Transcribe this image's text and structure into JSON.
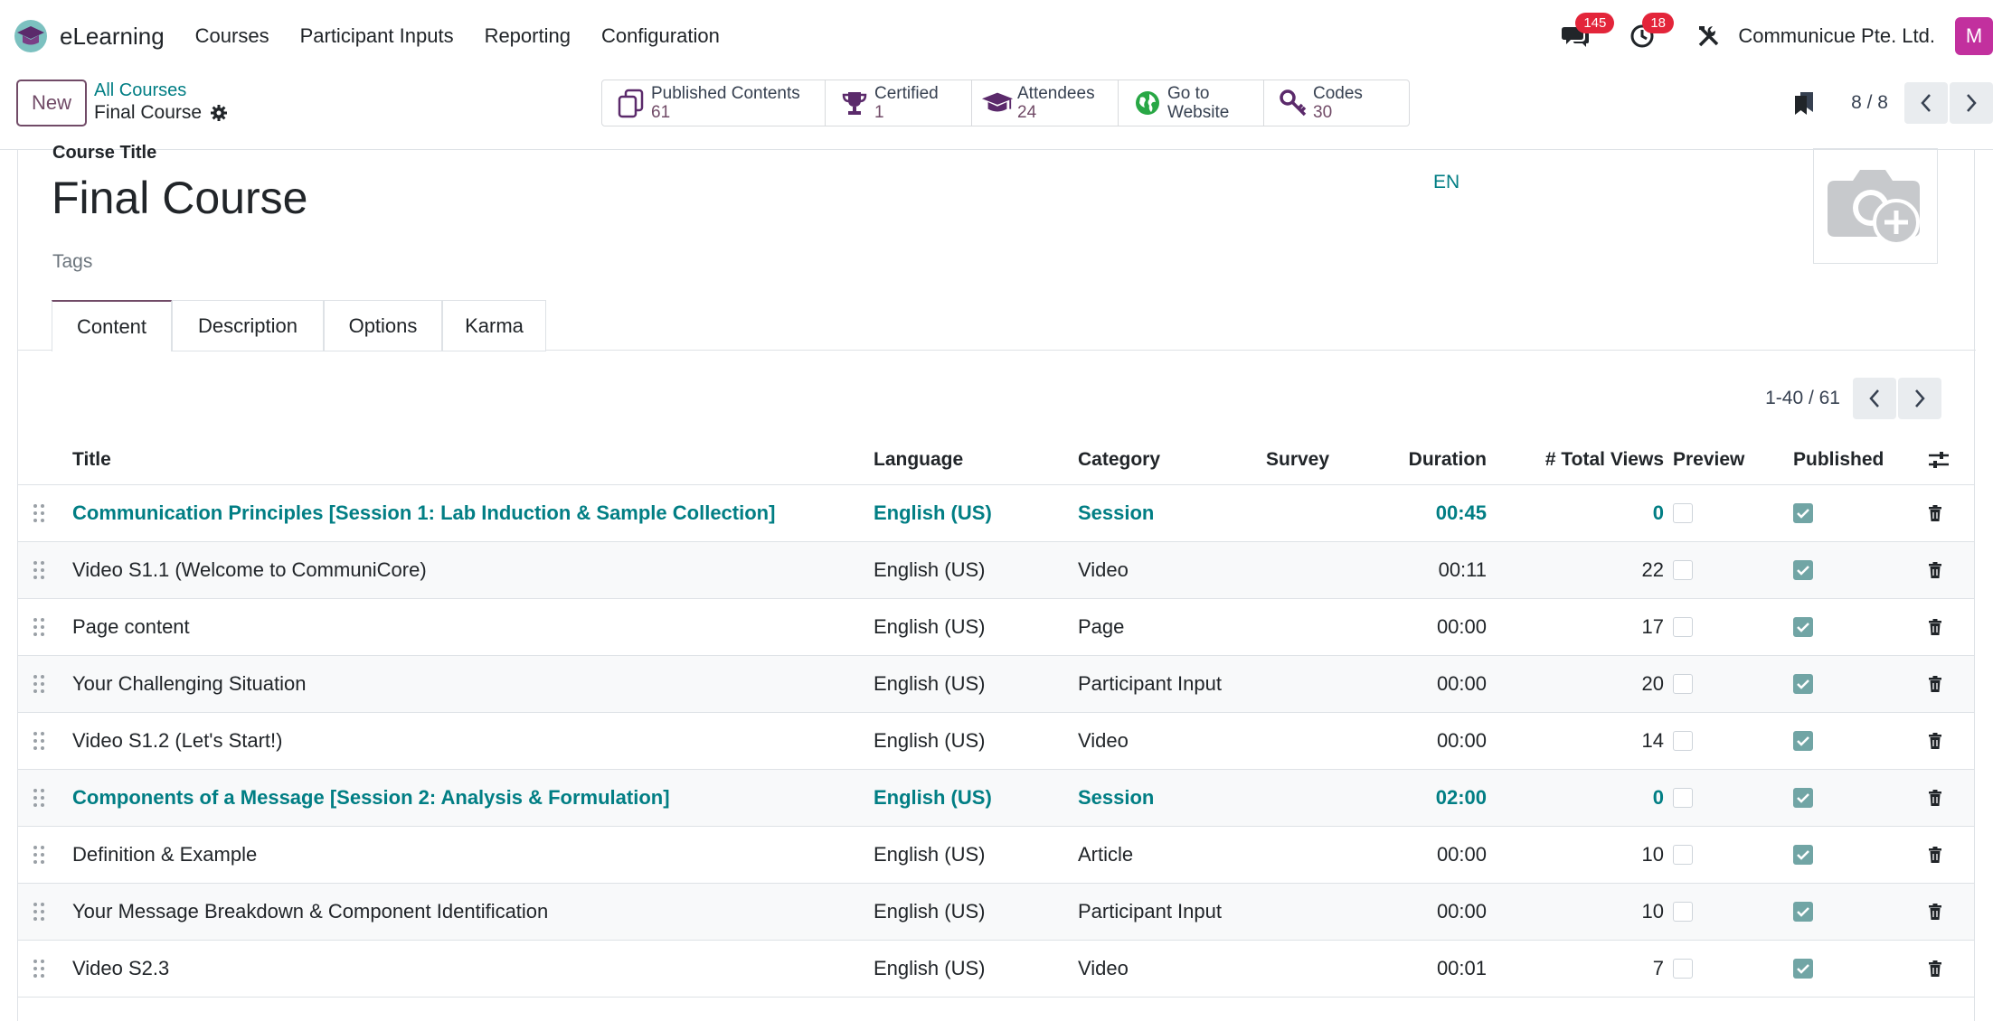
{
  "navbar": {
    "app_name": "eLearning",
    "menu": [
      "Courses",
      "Participant Inputs",
      "Reporting",
      "Configuration"
    ],
    "messages_badge": "145",
    "activities_badge": "18",
    "company": "Communicue Pte. Ltd.",
    "avatar_initial": "M"
  },
  "control": {
    "new_label": "New",
    "breadcrumb_parent": "All Courses",
    "breadcrumb_current": "Final Course",
    "smart_buttons": [
      {
        "label": "Published Contents",
        "value": "61",
        "icon": "copy-icon"
      },
      {
        "label": "Certified",
        "value": "1",
        "icon": "trophy-icon"
      },
      {
        "label": "Attendees",
        "value": "24",
        "icon": "graduation-cap-icon"
      },
      {
        "label": "Go to",
        "value": "Website",
        "icon": "globe-icon"
      },
      {
        "label": "Codes",
        "value": "30",
        "icon": "key-icon"
      }
    ],
    "record_pager": "8 / 8"
  },
  "form": {
    "title_label": "Course Title",
    "title_value": "Final Course",
    "lang_button": "EN",
    "tags_placeholder": "Tags",
    "tabs": [
      "Content",
      "Description",
      "Options",
      "Karma"
    ],
    "list_pager": "1-40 / 61"
  },
  "table": {
    "columns": {
      "title": "Title",
      "language": "Language",
      "category": "Category",
      "survey": "Survey",
      "duration": "Duration",
      "views": "# Total Views",
      "preview": "Preview",
      "published": "Published"
    },
    "rows": [
      {
        "title": "Communication Principles [Session 1: Lab Induction & Sample Collection]",
        "language": "English (US)",
        "category": "Session",
        "survey": "",
        "duration": "00:45",
        "views": "0",
        "preview": false,
        "published": true,
        "section": true
      },
      {
        "title": "Video S1.1 (Welcome to CommuniCore)",
        "language": "English (US)",
        "category": "Video",
        "survey": "",
        "duration": "00:11",
        "views": "22",
        "preview": false,
        "published": true,
        "section": false
      },
      {
        "title": "Page content",
        "language": "English (US)",
        "category": "Page",
        "survey": "",
        "duration": "00:00",
        "views": "17",
        "preview": false,
        "published": true,
        "section": false
      },
      {
        "title": "Your Challenging Situation",
        "language": "English (US)",
        "category": "Participant Input",
        "survey": "",
        "duration": "00:00",
        "views": "20",
        "preview": false,
        "published": true,
        "section": false
      },
      {
        "title": "Video S1.2 (Let's Start!)",
        "language": "English (US)",
        "category": "Video",
        "survey": "",
        "duration": "00:00",
        "views": "14",
        "preview": false,
        "published": true,
        "section": false
      },
      {
        "title": "Components of a Message [Session 2: Analysis & Formulation]",
        "language": "English (US)",
        "category": "Session",
        "survey": "",
        "duration": "02:00",
        "views": "0",
        "preview": false,
        "published": true,
        "section": true
      },
      {
        "title": "Definition & Example",
        "language": "English (US)",
        "category": "Article",
        "survey": "",
        "duration": "00:00",
        "views": "10",
        "preview": false,
        "published": true,
        "section": false
      },
      {
        "title": "Your Message Breakdown & Component Identification",
        "language": "English (US)",
        "category": "Participant Input",
        "survey": "",
        "duration": "00:00",
        "views": "10",
        "preview": false,
        "published": true,
        "section": false
      },
      {
        "title": "Video S2.3",
        "language": "English (US)",
        "category": "Video",
        "survey": "",
        "duration": "00:01",
        "views": "7",
        "preview": false,
        "published": true,
        "section": false
      }
    ]
  },
  "colors": {
    "brand": "#714b67",
    "link": "#017e84",
    "badge": "#e3253a",
    "avatar": "#c2309e",
    "checkbox_on": "#71a5a5"
  }
}
